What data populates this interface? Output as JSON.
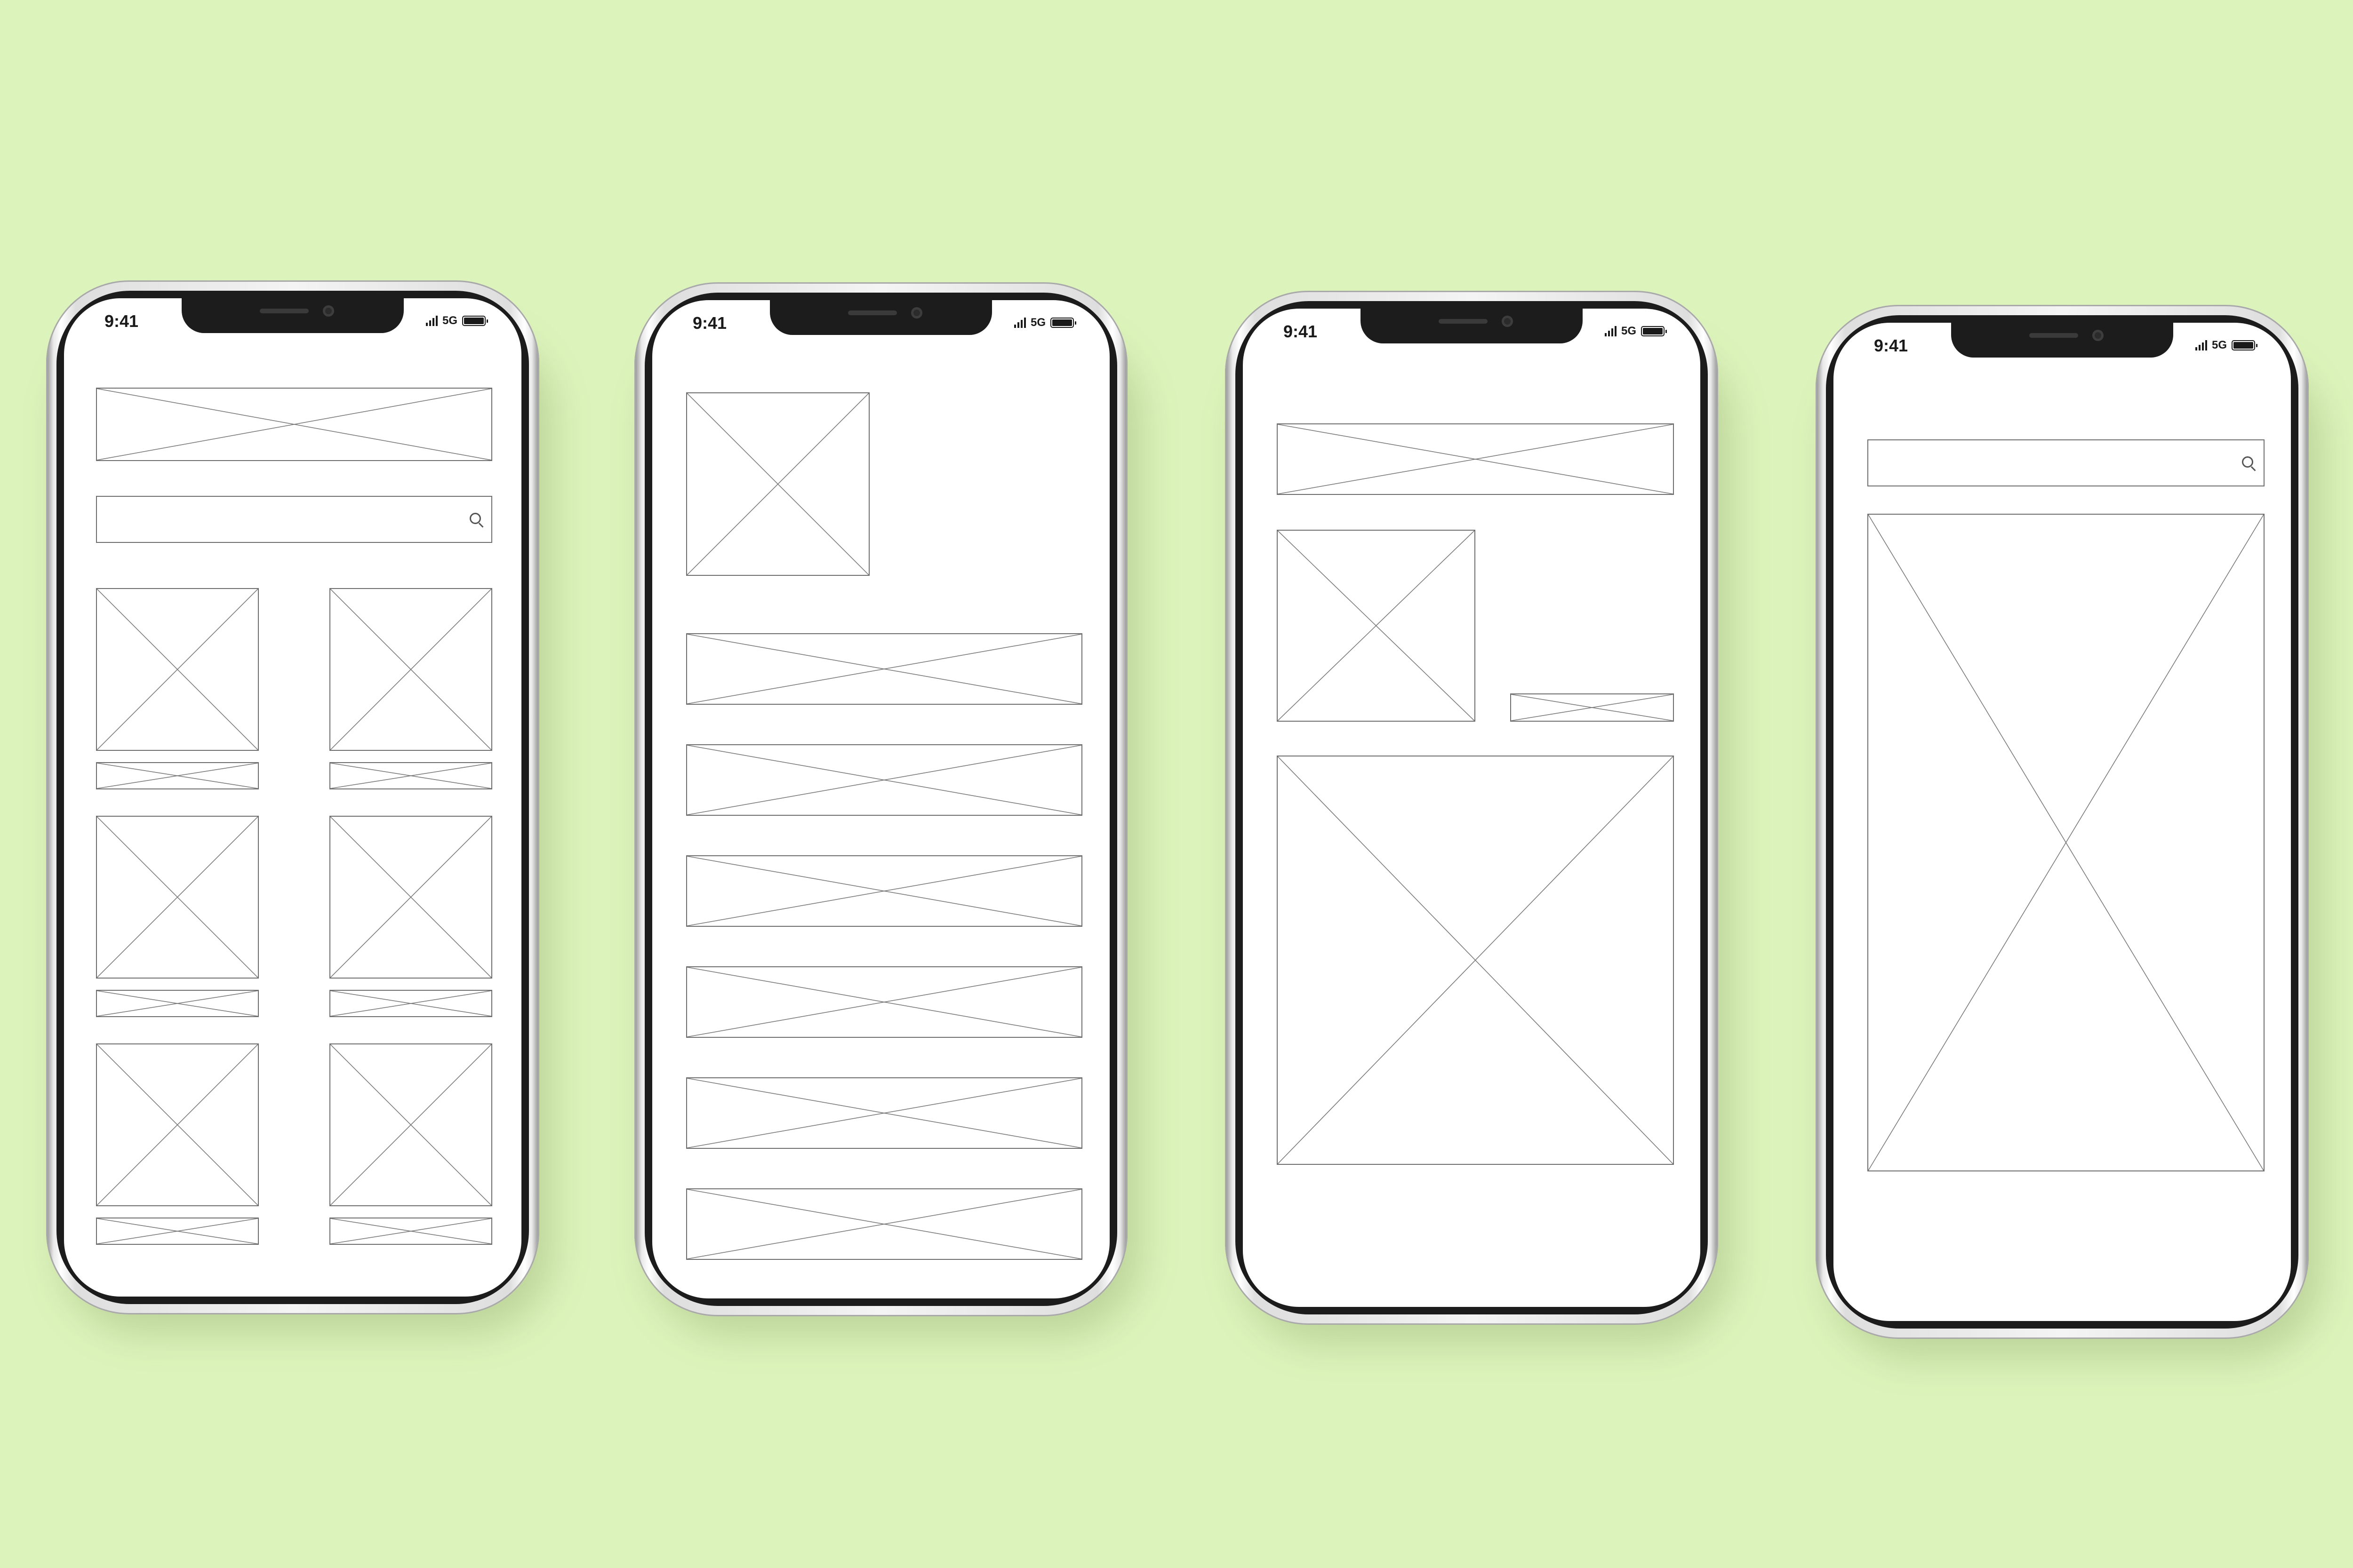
{
  "background_color": "#dcf3bb",
  "status_bar": {
    "time": "9:41",
    "network": "5G",
    "icons": [
      "cellular-signal-icon",
      "battery-icon"
    ]
  },
  "phones": [
    {
      "name": "product-grid-wireframe",
      "placeholders": [
        "banner",
        "search-bar",
        "product-image",
        "caption",
        "product-image",
        "caption",
        "product-image",
        "caption",
        "product-image",
        "caption",
        "product-image",
        "caption",
        "product-image",
        "caption"
      ]
    },
    {
      "name": "profile-list-wireframe",
      "placeholders": [
        "avatar-image",
        "list-row",
        "list-row",
        "list-row",
        "list-row",
        "list-row",
        "list-row"
      ]
    },
    {
      "name": "detail-wireframe",
      "placeholders": [
        "banner",
        "thumbnail-image",
        "label",
        "hero-image"
      ]
    },
    {
      "name": "search-media-wireframe",
      "placeholders": [
        "search-bar",
        "full-media"
      ]
    }
  ]
}
